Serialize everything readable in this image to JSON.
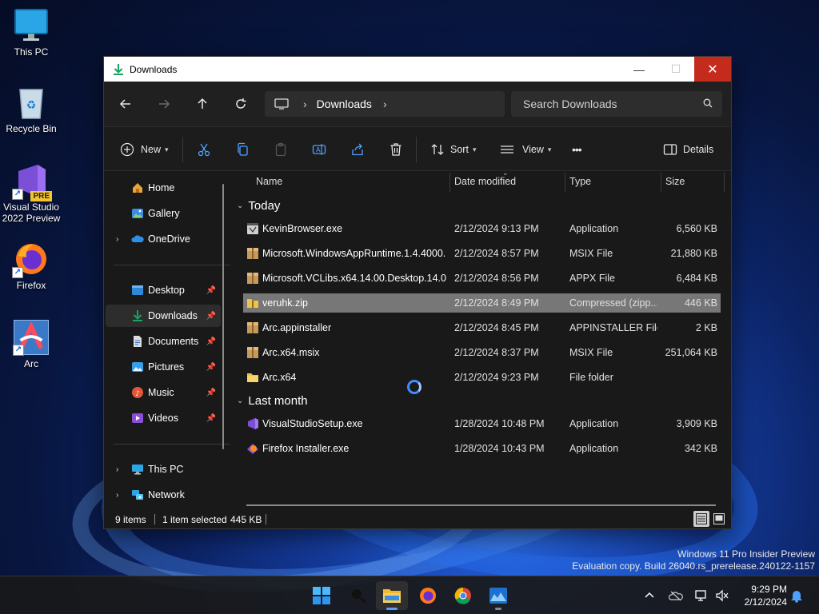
{
  "desktop": {
    "icons": [
      {
        "label": "This PC"
      },
      {
        "label": "Recycle Bin"
      },
      {
        "label": "Visual Studio 2022 Preview",
        "badge": "PRE"
      },
      {
        "label": "Firefox"
      },
      {
        "label": "Arc"
      }
    ],
    "watermark": {
      "line1": "Windows 11 Pro Insider Preview",
      "line2": "Evaluation copy. Build 26040.rs_prerelease.240122-1157"
    }
  },
  "window": {
    "title": "Downloads",
    "address": {
      "crumb": "Downloads"
    },
    "search": {
      "placeholder": "Search Downloads"
    },
    "toolbar": {
      "new_label": "New",
      "sort_label": "Sort",
      "view_label": "View",
      "more_label": "•••",
      "details_label": "Details"
    },
    "sidebar": {
      "items": [
        {
          "label": "Home"
        },
        {
          "label": "Gallery"
        },
        {
          "label": "OneDrive"
        },
        {
          "label": "Desktop"
        },
        {
          "label": "Downloads"
        },
        {
          "label": "Documents"
        },
        {
          "label": "Pictures"
        },
        {
          "label": "Music"
        },
        {
          "label": "Videos"
        },
        {
          "label": "This PC"
        },
        {
          "label": "Network"
        }
      ]
    },
    "columns": {
      "name": "Name",
      "date": "Date modified",
      "type": "Type",
      "size": "Size"
    },
    "groups": [
      {
        "label": "Today",
        "files": [
          {
            "name": "KevinBrowser.exe",
            "date": "2/12/2024 9:13 PM",
            "type": "Application",
            "size": "6,560 KB"
          },
          {
            "name": "Microsoft.WindowsAppRuntime.1.4.4000...",
            "date": "2/12/2024 8:57 PM",
            "type": "MSIX File",
            "size": "21,880 KB"
          },
          {
            "name": "Microsoft.VCLibs.x64.14.00.Desktop.14.0....",
            "date": "2/12/2024 8:56 PM",
            "type": "APPX File",
            "size": "6,484 KB"
          },
          {
            "name": "veruhk.zip",
            "date": "2/12/2024 8:49 PM",
            "type": "Compressed (zipp...",
            "size": "446 KB"
          },
          {
            "name": "Arc.appinstaller",
            "date": "2/12/2024 8:45 PM",
            "type": "APPINSTALLER File",
            "size": "2 KB"
          },
          {
            "name": "Arc.x64.msix",
            "date": "2/12/2024 8:37 PM",
            "type": "MSIX File",
            "size": "251,064 KB"
          },
          {
            "name": "Arc.x64",
            "date": "2/12/2024 9:23 PM",
            "type": "File folder",
            "size": ""
          }
        ]
      },
      {
        "label": "Last month",
        "files": [
          {
            "name": "VisualStudioSetup.exe",
            "date": "1/28/2024 10:48 PM",
            "type": "Application",
            "size": "3,909 KB"
          },
          {
            "name": "Firefox Installer.exe",
            "date": "1/28/2024 10:43 PM",
            "type": "Application",
            "size": "342 KB"
          }
        ]
      }
    ],
    "status": {
      "count": "9 items",
      "selected": "1 item selected",
      "size": "445 KB"
    }
  },
  "taskbar": {
    "time": "9:29 PM",
    "date": "2/12/2024"
  },
  "colors": {
    "accent": "#3f8cff",
    "close_button": "#c42b1c",
    "selection": "#777777"
  }
}
